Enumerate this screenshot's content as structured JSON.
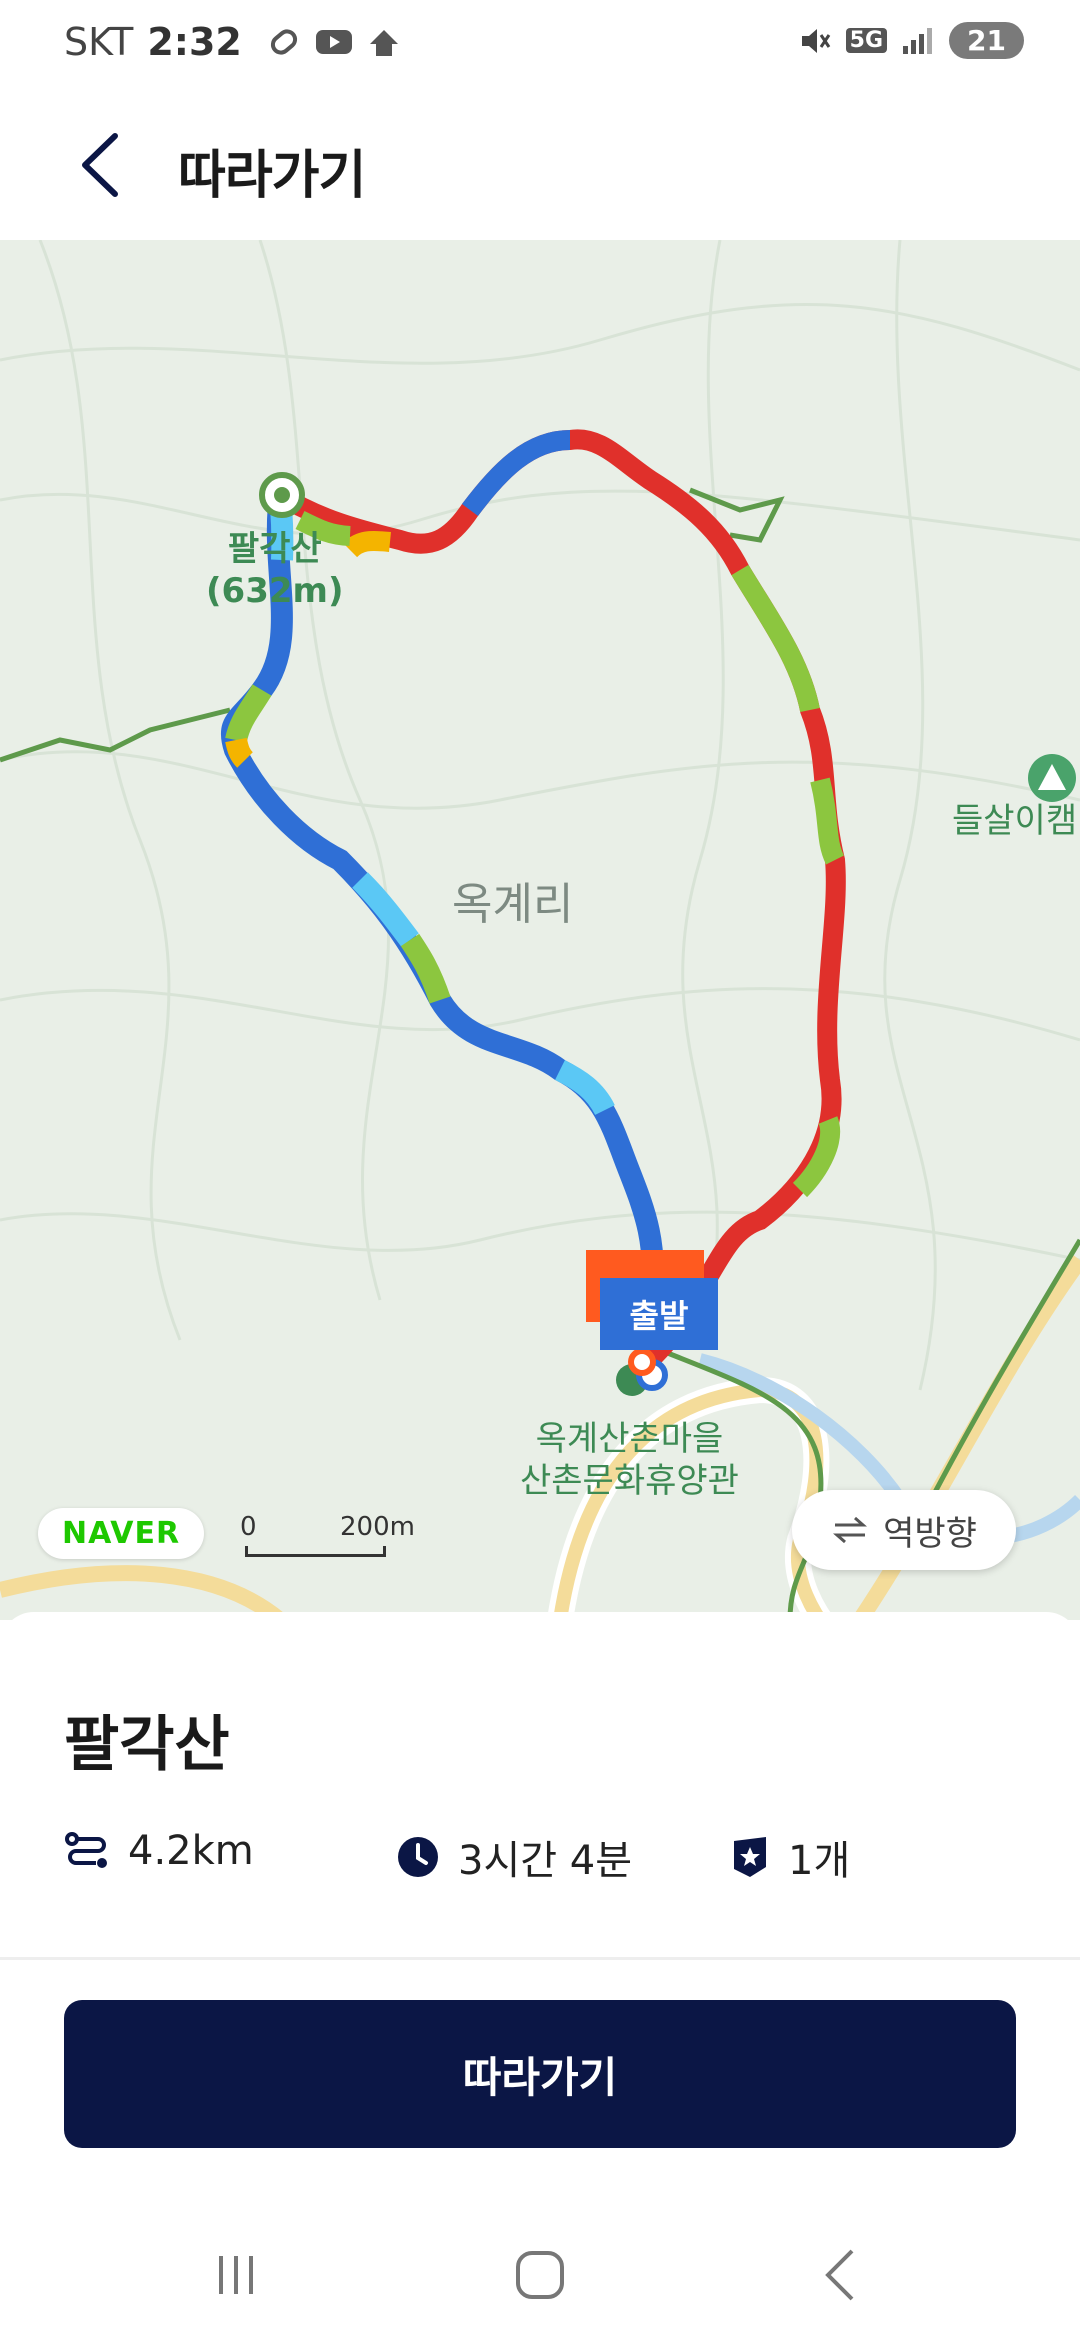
{
  "status_bar": {
    "carrier": "SKT",
    "time": "2:32",
    "network": "5G",
    "battery": "21"
  },
  "header": {
    "title": "따라가기"
  },
  "map": {
    "peak_label": "팔각산\n(632m)",
    "peak_name": "팔각산",
    "peak_elevation": "(632m)",
    "village_label": "옥계리",
    "lodge_label_line1": "옥계산촌마을",
    "lodge_label_line2": "산촌문화휴양관",
    "campsite_label": "들살이캠",
    "start_marker": "출발",
    "provider_logo": "NAVER",
    "scale_zero": "0",
    "scale_distance": "200m",
    "reverse_button": "역방향"
  },
  "trail": {
    "name": "팔각산",
    "distance": "4.2km",
    "duration": "3시간 4분",
    "stamps": "1개"
  },
  "follow_button": "따라가기",
  "colors": {
    "primary": "#0b1645",
    "route_blue": "#2f6fd6",
    "route_red": "#e0302b",
    "route_green": "#8cc63f",
    "map_green": "#3d8a54"
  },
  "icons": [
    "back-icon",
    "distance-icon",
    "clock-icon",
    "stamp-icon",
    "swap-icon",
    "recent-apps-icon",
    "home-icon",
    "nav-back-icon"
  ]
}
